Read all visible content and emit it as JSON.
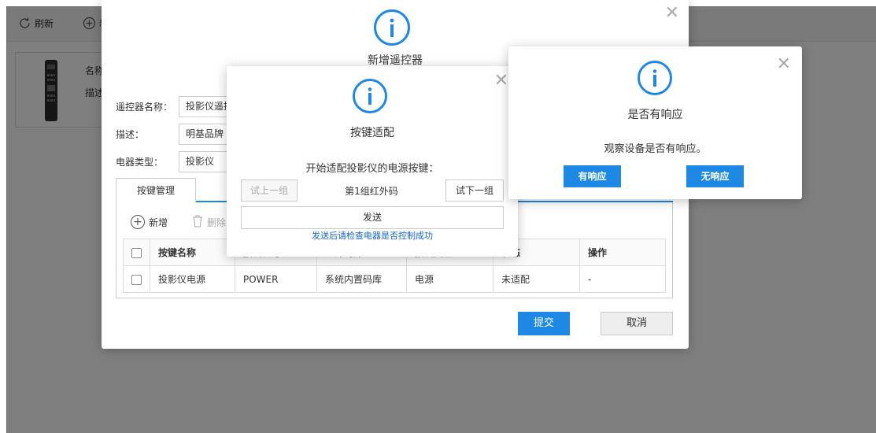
{
  "toolbar": {
    "refresh_label": "刷新",
    "add_label": "新增"
  },
  "card": {
    "name_label": "名称",
    "desc_label": "描述"
  },
  "dialog_new": {
    "title": "新增遥控器",
    "fields": [
      {
        "label": "遥控器名称：",
        "value": "投影仪遥控器"
      },
      {
        "label": "描述：",
        "value": "明基品牌"
      },
      {
        "label": "电器类型：",
        "value": "投影仪"
      }
    ],
    "tab_label": "按键管理",
    "add_label": "新增",
    "delete_label": "删除",
    "table": {
      "headers": [
        "按键名称",
        "按键代号",
        "红外码库",
        "按键类型",
        "状态",
        "操作"
      ],
      "rows": [
        {
          "name": "投影仪电源",
          "code": "POWER",
          "lib": "系统内置码库",
          "type": "电源",
          "status": "未适配",
          "op": "-"
        }
      ]
    },
    "submit_label": "提交",
    "cancel_label": "取消"
  },
  "dialog_adapt": {
    "title": "按键适配",
    "instruction": "开始适配投影仪的电源按键：",
    "prev_label": "试上一组",
    "group_text": "第1组红外码",
    "next_label": "试下一组",
    "send_label": "发送",
    "hint": "发送后请检查电器是否控制成功"
  },
  "dialog_confirm": {
    "title": "是否有响应",
    "message": "观察设备是否有响应。",
    "yes_label": "有响应",
    "no_label": "无响应"
  },
  "colors": {
    "accent": "#1e88e5",
    "hint_text": "#1565c0",
    "overlay": "rgba(0,0,0,0.5)"
  }
}
